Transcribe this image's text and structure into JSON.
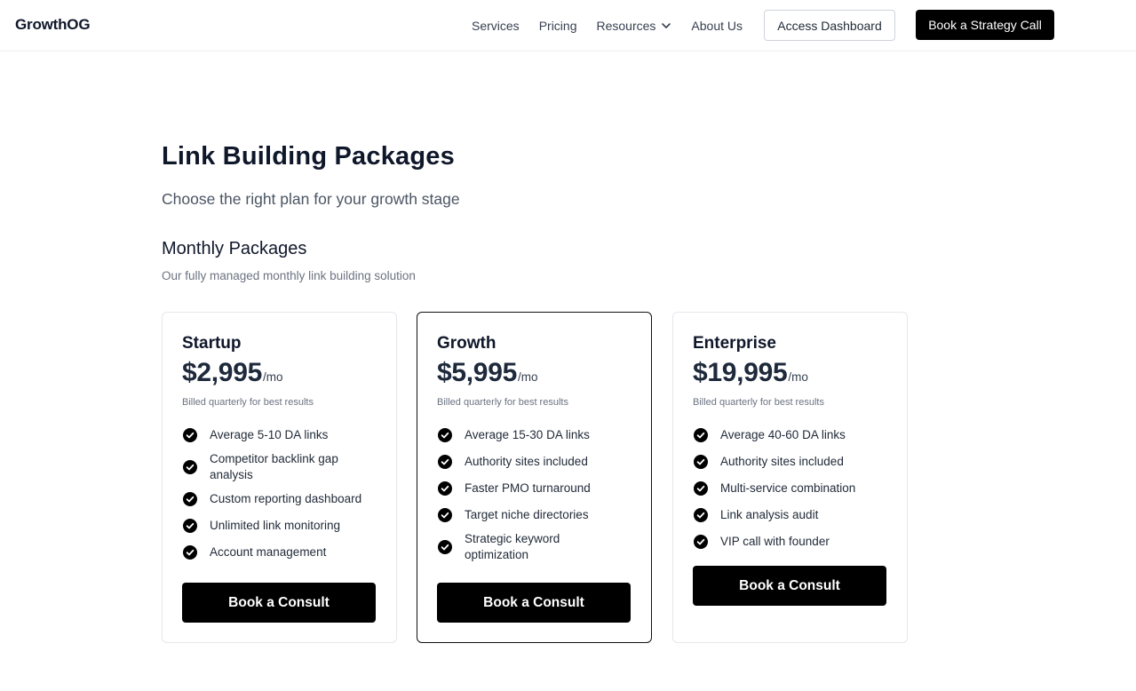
{
  "nav": {
    "logo": "GrowthOG",
    "links": [
      "Services",
      "Pricing",
      "Resources",
      "About Us"
    ],
    "access_label": "Access Dashboard",
    "cta_label": "Book a Strategy Call"
  },
  "hero": {
    "title": "Link Building Packages",
    "subtitle": "Choose the right plan for your growth stage"
  },
  "section": {
    "title": "Monthly Packages",
    "subtitle": "Our fully managed monthly link building solution"
  },
  "plans": [
    {
      "name": "Startup",
      "price": "$2,995",
      "period": "/mo",
      "billing": "Billed quarterly for best results",
      "features": [
        "Average 5-10 DA links",
        "Competitor backlink gap analysis",
        "Custom reporting dashboard",
        "Unlimited link monitoring",
        "Account management"
      ],
      "button": "Book a Consult"
    },
    {
      "name": "Growth",
      "price": "$5,995",
      "period": "/mo",
      "billing": "Billed quarterly for best results",
      "features": [
        "Average 15-30 DA links",
        "Authority sites included",
        "Faster PMO turnaround",
        "Target niche directories",
        "Strategic keyword optimization"
      ],
      "button": "Book a Consult"
    },
    {
      "name": "Enterprise",
      "price": "$19,995",
      "period": "/mo",
      "billing": "Billed quarterly for best results",
      "features": [
        "Average 40-60 DA links",
        "Authority sites included",
        "Multi-service combination",
        "Link analysis audit",
        "VIP call with founder"
      ],
      "button": "Book a Consult"
    }
  ],
  "icons": {
    "check": "check-circle-icon",
    "dropdown": "chevron-down-icon"
  },
  "colors": {
    "primary": "#000000",
    "text": "#0f172a",
    "muted": "#6b7280",
    "border": "#e5e7eb"
  }
}
